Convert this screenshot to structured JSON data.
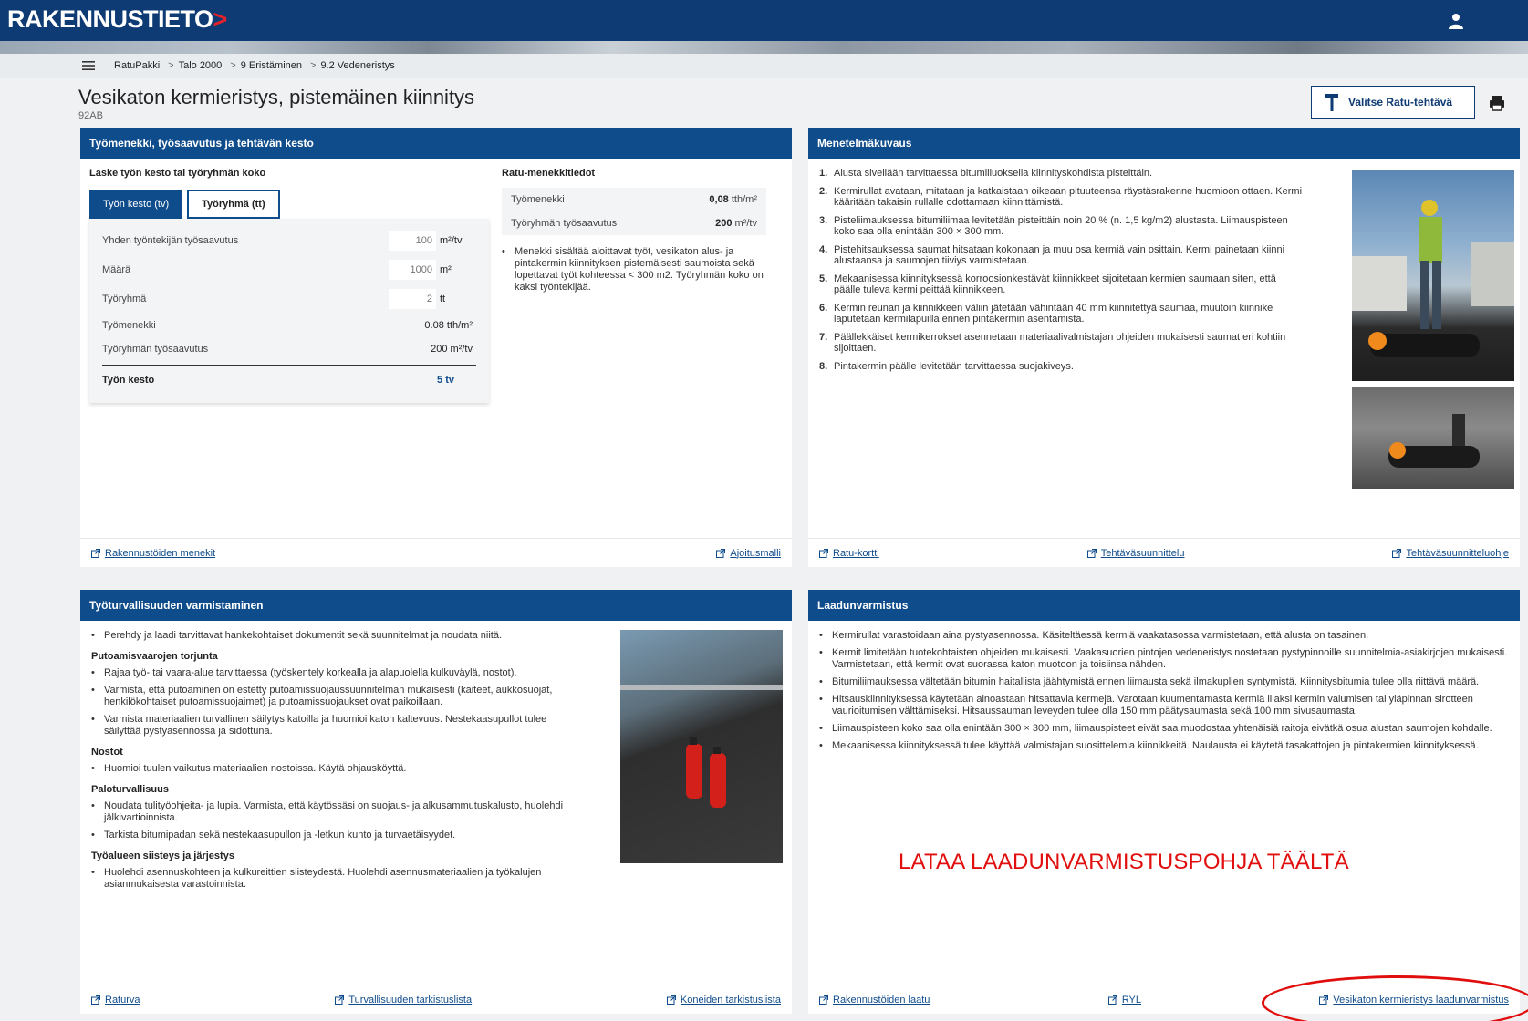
{
  "header": {
    "brand": "RAKENNUSTIETO",
    "brand_chevron": ">"
  },
  "breadcrumb": [
    "RatuPakki",
    "Talo 2000",
    "9 Eristäminen",
    "9.2 Vedeneristys"
  ],
  "breadcrumb_sep": ">",
  "page": {
    "title": "Vesikaton kermieristys, pistemäinen kiinnitys",
    "code": "92AB",
    "select_button": "Valitse Ratu-tehtävä"
  },
  "panel_work": {
    "title": "Työmenekki, työsaavutus ja tehtävän kesto",
    "calc_title": "Laske työn kesto tai työryhmän koko",
    "tabs": [
      "Työn kesto (tv)",
      "Työryhmä (tt)"
    ],
    "rows": [
      {
        "label": "Yhden työntekijän työsaavutus",
        "value": "100",
        "unit": "m²/tv"
      },
      {
        "label": "Määrä",
        "value": "1000",
        "unit": "m²"
      },
      {
        "label": "Työryhmä",
        "value": "2",
        "unit": "tt"
      }
    ],
    "results": [
      {
        "label": "Työmenekki",
        "value": "0.08 tth/m²"
      },
      {
        "label": "Työryhmän työsaavutus",
        "value": "200 m²/tv"
      }
    ],
    "total": {
      "label": "Työn kesto",
      "value": "5 tv"
    },
    "ratu_title": "Ratu-menekkitiedot",
    "ratu_rows": [
      {
        "label": "Työmenekki",
        "value": "0,08",
        "unit": "tth/m²"
      },
      {
        "label": "Työryhmän työsaavutus",
        "value": "200",
        "unit": "m²/tv"
      }
    ],
    "ratu_note": "Menekki sisältää aloittavat työt, vesikaton alus- ja pintakermin kiinnityksen pistemäisesti saumoista sekä lopettavat työt kohteessa < 300 m2. Työryhmän koko on kaksi työntekijää.",
    "links": [
      "Rakennustöiden menekit",
      "Ajoitusmalli"
    ]
  },
  "panel_method": {
    "title": "Menetelmäkuvaus",
    "steps": [
      "Alusta sivellään tarvittaessa bitumiliuoksella kiinnityskohdista pisteittäin.",
      "Kermirullat avataan, mitataan ja katkaistaan oikeaan pituuteensa räystäsrakenne huomioon ottaen. Kermi kääritään takaisin rullalle odottamaan kiinnittämistä.",
      "Pisteliimauksessa bitumiliimaa levitetään pisteittäin noin 20 % (n. 1,5 kg/m2) alustasta. Liimauspisteen koko saa olla enintään 300 × 300 mm.",
      "Pistehitsauksessa saumat hitsataan kokonaan ja muu osa kermiä vain osittain. Kermi painetaan kiinni alustaansa ja saumojen tiiviys varmistetaan.",
      "Mekaanisessa kiinnityksessä korroosionkestävät kiinnikkeet sijoitetaan kermien saumaan siten, että päälle tuleva kermi peittää kiinnikkeen.",
      "Kermin reunan ja kiinnikkeen väliin jätetään vähintään 40 mm kiinnitettyä saumaa, muutoin kiinnike laputetaan kermilapuilla ennen pintakermin asentamista.",
      "Päällekkäiset kermikerrokset asennetaan materiaalivalmistajan ohjeiden mukaisesti saumat eri kohtiin sijoittaen.",
      "Pintakermin päälle levitetään tarvittaessa suojakiveys."
    ],
    "links": [
      "Ratu-kortti",
      "Tehtäväsuunnittelu",
      "Tehtäväsuunnitteluohje"
    ]
  },
  "panel_safety": {
    "title": "Työturvallisuuden varmistaminen",
    "intro": "Perehdy ja laadi tarvittavat hankekohtaiset dokumentit sekä suunnitelmat ja noudata niitä.",
    "sections": [
      {
        "heading": "Putoamisvaarojen torjunta",
        "items": [
          "Rajaa työ- tai vaara-alue tarvittaessa (työskentely korkealla ja alapuolella kulkuväylä, nostot).",
          "Varmista, että putoaminen on estetty putoamissuojaussuunnitelman mukaisesti (kaiteet, aukkosuojat, henkilökohtaiset putoamissuojaimet) ja putoamissuojaukset ovat paikoillaan.",
          "Varmista materiaalien turvallinen säilytys katoilla ja huomioi katon kaltevuus. Nestekaasupullot tulee säilyttää pystyasennossa ja sidottuna."
        ]
      },
      {
        "heading": "Nostot",
        "items": [
          "Huomioi tuulen vaikutus materiaalien nostoissa. Käytä ohjausköyttä."
        ]
      },
      {
        "heading": "Paloturvallisuus",
        "items": [
          "Noudata tulityöohjeita- ja lupia. Varmista, että käytössäsi on suojaus- ja alkusammutuskalusto, huolehdi jälkivartioinnista.",
          "Tarkista bitumipadan sekä nestekaasupullon ja -letkun kunto ja turvaetäisyydet."
        ]
      },
      {
        "heading": "Työalueen siisteys ja järjestys",
        "items": [
          "Huolehdi asennuskohteen ja kulkureittien siisteydestä. Huolehdi asennusmateriaalien ja työkalujen asianmukaisesta varastoinnista."
        ]
      }
    ],
    "links": [
      "Raturva",
      "Turvallisuuden tarkistuslista",
      "Koneiden tarkistuslista"
    ]
  },
  "panel_quality": {
    "title": "Laadunvarmistus",
    "items": [
      "Kermirullat varastoidaan aina pystyasennossa. Käsiteltäessä kermiä vaakatasossa varmistetaan, että alusta on tasainen.",
      "Kermit limitetään tuotekohtaisten ohjeiden mukaisesti. Vaakasuorien pintojen vedeneristys nostetaan pystypinnoille suunnitelmia-asiakirjojen mukaisesti. Varmistetaan, että kermit ovat suorassa katon muotoon ja toisiinsa nähden.",
      "Bitumiliimauksessa vältetään bitumin haitallista jäähtymistä ennen liimausta sekä ilmakuplien syntymistä. Kiinnitysbitumia tulee olla riittävä määrä.",
      "Hitsauskiinnityksessä käytetään ainoastaan hitsattavia kermejä. Varotaan kuumentamasta kermiä liiaksi kermin valumisen tai yläpinnan sirotteen vaurioitumisen välttämiseksi. Hitsaussauman leveyden tulee olla 150 mm päätysaumasta sekä 100 mm sivusaumasta.",
      "Liimauspisteen koko saa olla enintään 300 × 300 mm, liimauspisteet eivät saa muodostaa yhtenäisiä raitoja eivätkä osua alustan saumojen kohdalle.",
      "Mekaanisessa kiinnityksessä tulee käyttää valmistajan suosittelemia kiinnikkeitä. Naulausta ei käytetä tasakattojen ja pintakermien kiinnityksessä."
    ],
    "links": [
      "Rakennustöiden laatu",
      "RYL",
      "Vesikaton kermieristys laadunvarmistus"
    ]
  },
  "annotation": {
    "text": "LATAA LAADUNVARMISTUSPOHJA TÄÄLTÄ",
    "color": "#e10e0e"
  },
  "colors": {
    "header": "#0e3b73",
    "panel_head": "#0f4c8b",
    "accent_red": "#e3232a"
  }
}
